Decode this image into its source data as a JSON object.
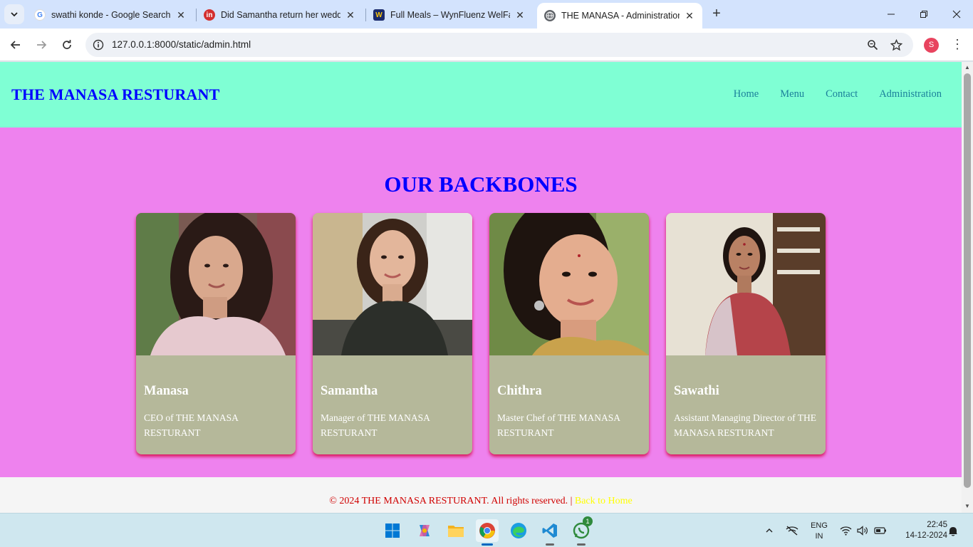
{
  "browser": {
    "tabs": [
      {
        "title": "swathi konde - Google Search",
        "favicon": "google-g-icon"
      },
      {
        "title": "Did Samantha return her wedd",
        "favicon": "inshorts-icon"
      },
      {
        "title": "Full Meals – WynFluenz WelFare",
        "favicon": "wynfluenz-icon"
      },
      {
        "title": "THE MANASA - Administration",
        "favicon": "globe-icon",
        "active": true
      }
    ],
    "address": "127.0.0.1:8000/static/admin.html",
    "profile_initial": "S"
  },
  "site": {
    "brand": "THE MANASA RESTURANT",
    "nav": [
      {
        "label": "Home"
      },
      {
        "label": "Menu"
      },
      {
        "label": "Contact"
      },
      {
        "label": "Administration"
      }
    ],
    "heading": "OUR BACKBONES",
    "team": [
      {
        "name": "Manasa",
        "role": "CEO of THE MANASA RESTURANT"
      },
      {
        "name": "Samantha",
        "role": "Manager of THE MANASA RESTURANT"
      },
      {
        "name": "Chithra",
        "role": "Master Chef of THE MANASA RESTURANT"
      },
      {
        "name": "Sawathi",
        "role": "Assistant Managing Director of THE MANASA RESTURANT"
      }
    ],
    "footer": {
      "text": "© 2024 THE MANASA RESTURANT. All rights reserved. | ",
      "link": "Back to Home"
    },
    "colors": {
      "header_bg": "#7fffd4",
      "hero_bg": "#ee82ee",
      "brand_blue": "#0000ff",
      "card_bg": "#b5b89a",
      "footer_text": "#d00000",
      "footer_link": "#ffff00"
    }
  },
  "taskbar": {
    "apps": [
      "windows-start-icon",
      "copilot-icon",
      "file-explorer-icon",
      "chrome-icon",
      "edge-icon",
      "vscode-icon",
      "whatsapp-icon"
    ],
    "whatsapp_badge": "1",
    "lang_line1": "ENG",
    "lang_line2": "IN",
    "time": "22:45",
    "date": "14-12-2024"
  }
}
